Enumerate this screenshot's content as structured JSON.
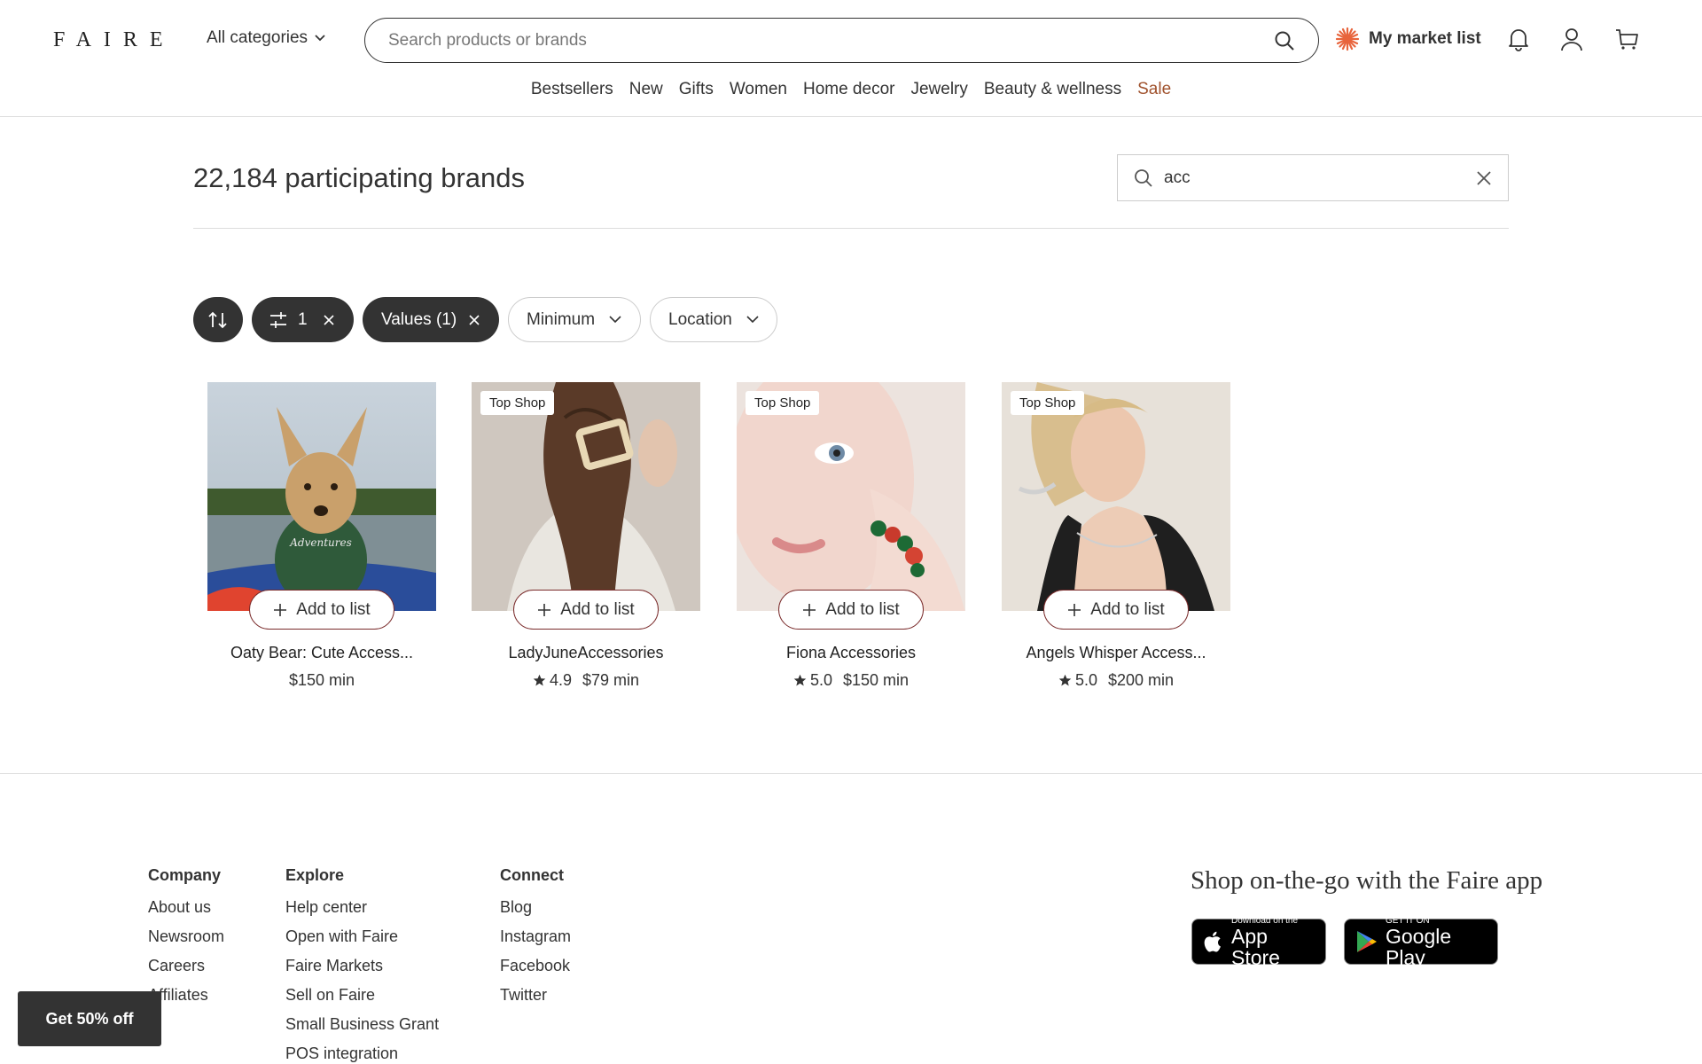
{
  "header": {
    "logo": "FAIRE",
    "categories_label": "All categories",
    "search_placeholder": "Search products or brands",
    "market_list_label": "My market list",
    "nav": [
      {
        "label": "Bestsellers"
      },
      {
        "label": "New"
      },
      {
        "label": "Gifts"
      },
      {
        "label": "Women"
      },
      {
        "label": "Home decor"
      },
      {
        "label": "Jewelry"
      },
      {
        "label": "Beauty & wellness"
      },
      {
        "label": "Sale"
      }
    ]
  },
  "main": {
    "brand_count": "22,184 participating brands",
    "brand_search_value": "acc",
    "filters": {
      "filter_count": "1",
      "values_label": "Values (1)",
      "minimum_label": "Minimum",
      "location_label": "Location"
    },
    "cards": [
      {
        "name": "Oaty Bear: Cute Access...",
        "rating": "",
        "min": "$150 min",
        "badge": "",
        "add_label": "Add to list"
      },
      {
        "name": "LadyJuneAccessories",
        "rating": "4.9",
        "min": "$79 min",
        "badge": "Top Shop",
        "add_label": "Add to list"
      },
      {
        "name": "Fiona Accessories",
        "rating": "5.0",
        "min": "$150 min",
        "badge": "Top Shop",
        "add_label": "Add to list"
      },
      {
        "name": "Angels Whisper Access...",
        "rating": "5.0",
        "min": "$200 min",
        "badge": "Top Shop",
        "add_label": "Add to list"
      }
    ]
  },
  "footer": {
    "company": {
      "heading": "Company",
      "links": [
        "About us",
        "Newsroom",
        "Careers",
        "Affiliates"
      ]
    },
    "explore": {
      "heading": "Explore",
      "links": [
        "Help center",
        "Open with Faire",
        "Faire Markets",
        "Sell on Faire",
        "Small Business Grant",
        "POS integration"
      ]
    },
    "connect": {
      "heading": "Connect",
      "links": [
        "Blog",
        "Instagram",
        "Facebook",
        "Twitter"
      ]
    },
    "app_title": "Shop on-the-go with the Faire app",
    "app_store": {
      "small": "Download on the",
      "big": "App Store"
    },
    "google_play": {
      "small": "GET IT ON",
      "big": "Google Play"
    }
  },
  "promo": "Get 50% off",
  "colors": {
    "sale": "#a0522d",
    "dark_chip": "#333333",
    "add_border": "#7a2b2b",
    "accent_star": "#e8643c"
  }
}
